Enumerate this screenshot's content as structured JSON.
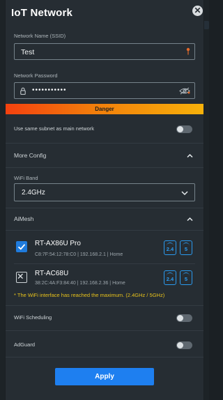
{
  "dialog": {
    "title": "IoT Network",
    "close_icon": "close-icon"
  },
  "network_name": {
    "label": "Network Name (SSID)",
    "value": "Test"
  },
  "network_password": {
    "label": "Network Password",
    "value": "•••••••••••"
  },
  "strength": {
    "label": "Danger",
    "colors": [
      "#f4410f",
      "#f7b10a"
    ]
  },
  "same_subnet": {
    "label": "Use same subnet as main network",
    "enabled": false
  },
  "more_config": {
    "title": "More Config",
    "expanded": true
  },
  "wifi_band": {
    "label": "WiFi Band",
    "selected": "2.4GHz"
  },
  "aimesh": {
    "title": "AiMesh",
    "expanded": true,
    "nodes": [
      {
        "name": "RT-AX86U Pro",
        "mac": "C8:7F:54:12:78:C0",
        "ip": "192.168.2.1",
        "location": "Home",
        "checked": true,
        "bands": [
          "2.4",
          "5"
        ]
      },
      {
        "name": "RT-AC68U",
        "mac": "38:2C:4A:F3:84:40",
        "ip": "192.168.2.36",
        "location": "Home",
        "checked": false,
        "bands": [
          "2.4",
          "5"
        ]
      }
    ],
    "warning": "* The WiFi interface has reached the maximum. (2.4GHz / 5GHz)"
  },
  "wifi_scheduling": {
    "label": "WiFi Scheduling",
    "enabled": false
  },
  "adguard": {
    "label": "AdGuard",
    "enabled": false
  },
  "apply_button": {
    "label": "Apply"
  },
  "colors": {
    "accent": "#1e7ff0",
    "band_icon": "#2a9bf0",
    "warning_text": "#e8c21b"
  }
}
